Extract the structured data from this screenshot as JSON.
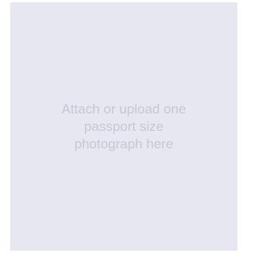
{
  "upload": {
    "instruction": "Attach or upload one passport size photograph here"
  }
}
